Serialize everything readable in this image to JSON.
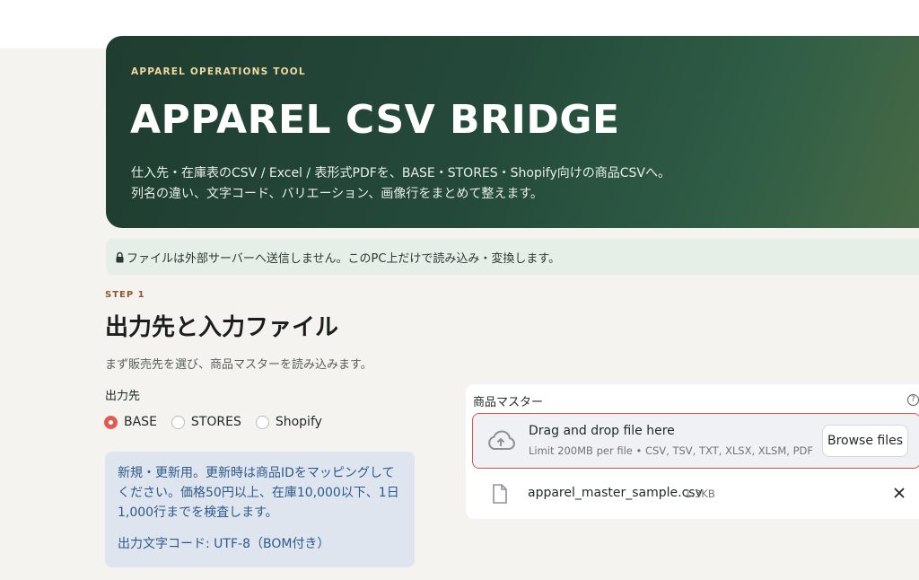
{
  "hero": {
    "eyebrow": "APPAREL OPERATIONS TOOL",
    "title": "APPAREL CSV BRIDGE",
    "desc_line1": "仕入先・在庫表のCSV / Excel / 表形式PDFを、BASE・STORES・Shopify向けの商品CSVへ。",
    "desc_line2": "列名の違い、文字コード、バリエーション、画像行をまとめて整えます。"
  },
  "notice": {
    "icon": "lock-icon",
    "text": "ファイルは外部サーバーへ送信しません。このPC上だけで読み込み・変換します。"
  },
  "step": {
    "label": "STEP 1",
    "title": "出力先と入力ファイル",
    "subtitle": "まず販売先を選び、商品マスターを読み込みます。"
  },
  "destination": {
    "label": "出力先",
    "options": [
      {
        "label": "BASE",
        "selected": true
      },
      {
        "label": "STORES",
        "selected": false
      },
      {
        "label": "Shopify",
        "selected": false
      }
    ]
  },
  "info": {
    "text": "新規・更新用。更新時は商品IDをマッピングしてください。価格50円以上、在庫10,000以下、1日1,000行までを検査します。",
    "encoding": "出力文字コード: UTF-8（BOM付き）"
  },
  "uploader": {
    "label": "商品マスター",
    "help_icon": "question-circle-icon",
    "drop_title": "Drag and drop file here",
    "drop_limit": "Limit 200MB per file • CSV, TSV, TXT, XLSX, XLSM, PDF",
    "browse_label": "Browse files",
    "file": {
      "name": "apparel_master_sample.csv",
      "size": "1.3KB"
    }
  },
  "colors": {
    "hero_start": "#1f3d30",
    "hero_end": "#4a6b45",
    "accent_red": "#e25b52",
    "step_brown": "#8a5a2c",
    "info_blue": "#2d5a8c"
  }
}
